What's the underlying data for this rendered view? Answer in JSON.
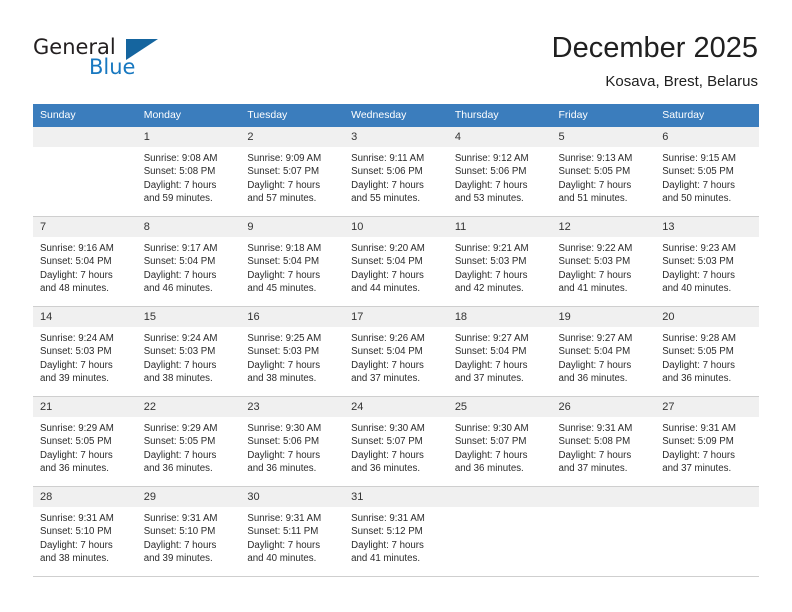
{
  "logo": {
    "word_top": "General",
    "word_bottom": "Blue",
    "triangle_color": "#15659f",
    "text_color": "#231f20",
    "blue_color": "#1878c0"
  },
  "header": {
    "title": "December 2025",
    "subtitle": "Kosava, Brest, Belarus"
  },
  "theme": {
    "header_bg": "#3b7dbd",
    "header_text": "#ffffff",
    "daynum_bg": "#f0f0f0",
    "grid_line": "#cfcfcf"
  },
  "calendar": {
    "weekdays": [
      "Sunday",
      "Monday",
      "Tuesday",
      "Wednesday",
      "Thursday",
      "Friday",
      "Saturday"
    ],
    "weeks": [
      [
        {
          "day": "",
          "sunrise": "",
          "sunset": "",
          "daylight_1": "",
          "daylight_2": ""
        },
        {
          "day": "1",
          "sunrise": "Sunrise: 9:08 AM",
          "sunset": "Sunset: 5:08 PM",
          "daylight_1": "Daylight: 7 hours",
          "daylight_2": "and 59 minutes."
        },
        {
          "day": "2",
          "sunrise": "Sunrise: 9:09 AM",
          "sunset": "Sunset: 5:07 PM",
          "daylight_1": "Daylight: 7 hours",
          "daylight_2": "and 57 minutes."
        },
        {
          "day": "3",
          "sunrise": "Sunrise: 9:11 AM",
          "sunset": "Sunset: 5:06 PM",
          "daylight_1": "Daylight: 7 hours",
          "daylight_2": "and 55 minutes."
        },
        {
          "day": "4",
          "sunrise": "Sunrise: 9:12 AM",
          "sunset": "Sunset: 5:06 PM",
          "daylight_1": "Daylight: 7 hours",
          "daylight_2": "and 53 minutes."
        },
        {
          "day": "5",
          "sunrise": "Sunrise: 9:13 AM",
          "sunset": "Sunset: 5:05 PM",
          "daylight_1": "Daylight: 7 hours",
          "daylight_2": "and 51 minutes."
        },
        {
          "day": "6",
          "sunrise": "Sunrise: 9:15 AM",
          "sunset": "Sunset: 5:05 PM",
          "daylight_1": "Daylight: 7 hours",
          "daylight_2": "and 50 minutes."
        }
      ],
      [
        {
          "day": "7",
          "sunrise": "Sunrise: 9:16 AM",
          "sunset": "Sunset: 5:04 PM",
          "daylight_1": "Daylight: 7 hours",
          "daylight_2": "and 48 minutes."
        },
        {
          "day": "8",
          "sunrise": "Sunrise: 9:17 AM",
          "sunset": "Sunset: 5:04 PM",
          "daylight_1": "Daylight: 7 hours",
          "daylight_2": "and 46 minutes."
        },
        {
          "day": "9",
          "sunrise": "Sunrise: 9:18 AM",
          "sunset": "Sunset: 5:04 PM",
          "daylight_1": "Daylight: 7 hours",
          "daylight_2": "and 45 minutes."
        },
        {
          "day": "10",
          "sunrise": "Sunrise: 9:20 AM",
          "sunset": "Sunset: 5:04 PM",
          "daylight_1": "Daylight: 7 hours",
          "daylight_2": "and 44 minutes."
        },
        {
          "day": "11",
          "sunrise": "Sunrise: 9:21 AM",
          "sunset": "Sunset: 5:03 PM",
          "daylight_1": "Daylight: 7 hours",
          "daylight_2": "and 42 minutes."
        },
        {
          "day": "12",
          "sunrise": "Sunrise: 9:22 AM",
          "sunset": "Sunset: 5:03 PM",
          "daylight_1": "Daylight: 7 hours",
          "daylight_2": "and 41 minutes."
        },
        {
          "day": "13",
          "sunrise": "Sunrise: 9:23 AM",
          "sunset": "Sunset: 5:03 PM",
          "daylight_1": "Daylight: 7 hours",
          "daylight_2": "and 40 minutes."
        }
      ],
      [
        {
          "day": "14",
          "sunrise": "Sunrise: 9:24 AM",
          "sunset": "Sunset: 5:03 PM",
          "daylight_1": "Daylight: 7 hours",
          "daylight_2": "and 39 minutes."
        },
        {
          "day": "15",
          "sunrise": "Sunrise: 9:24 AM",
          "sunset": "Sunset: 5:03 PM",
          "daylight_1": "Daylight: 7 hours",
          "daylight_2": "and 38 minutes."
        },
        {
          "day": "16",
          "sunrise": "Sunrise: 9:25 AM",
          "sunset": "Sunset: 5:03 PM",
          "daylight_1": "Daylight: 7 hours",
          "daylight_2": "and 38 minutes."
        },
        {
          "day": "17",
          "sunrise": "Sunrise: 9:26 AM",
          "sunset": "Sunset: 5:04 PM",
          "daylight_1": "Daylight: 7 hours",
          "daylight_2": "and 37 minutes."
        },
        {
          "day": "18",
          "sunrise": "Sunrise: 9:27 AM",
          "sunset": "Sunset: 5:04 PM",
          "daylight_1": "Daylight: 7 hours",
          "daylight_2": "and 37 minutes."
        },
        {
          "day": "19",
          "sunrise": "Sunrise: 9:27 AM",
          "sunset": "Sunset: 5:04 PM",
          "daylight_1": "Daylight: 7 hours",
          "daylight_2": "and 36 minutes."
        },
        {
          "day": "20",
          "sunrise": "Sunrise: 9:28 AM",
          "sunset": "Sunset: 5:05 PM",
          "daylight_1": "Daylight: 7 hours",
          "daylight_2": "and 36 minutes."
        }
      ],
      [
        {
          "day": "21",
          "sunrise": "Sunrise: 9:29 AM",
          "sunset": "Sunset: 5:05 PM",
          "daylight_1": "Daylight: 7 hours",
          "daylight_2": "and 36 minutes."
        },
        {
          "day": "22",
          "sunrise": "Sunrise: 9:29 AM",
          "sunset": "Sunset: 5:05 PM",
          "daylight_1": "Daylight: 7 hours",
          "daylight_2": "and 36 minutes."
        },
        {
          "day": "23",
          "sunrise": "Sunrise: 9:30 AM",
          "sunset": "Sunset: 5:06 PM",
          "daylight_1": "Daylight: 7 hours",
          "daylight_2": "and 36 minutes."
        },
        {
          "day": "24",
          "sunrise": "Sunrise: 9:30 AM",
          "sunset": "Sunset: 5:07 PM",
          "daylight_1": "Daylight: 7 hours",
          "daylight_2": "and 36 minutes."
        },
        {
          "day": "25",
          "sunrise": "Sunrise: 9:30 AM",
          "sunset": "Sunset: 5:07 PM",
          "daylight_1": "Daylight: 7 hours",
          "daylight_2": "and 36 minutes."
        },
        {
          "day": "26",
          "sunrise": "Sunrise: 9:31 AM",
          "sunset": "Sunset: 5:08 PM",
          "daylight_1": "Daylight: 7 hours",
          "daylight_2": "and 37 minutes."
        },
        {
          "day": "27",
          "sunrise": "Sunrise: 9:31 AM",
          "sunset": "Sunset: 5:09 PM",
          "daylight_1": "Daylight: 7 hours",
          "daylight_2": "and 37 minutes."
        }
      ],
      [
        {
          "day": "28",
          "sunrise": "Sunrise: 9:31 AM",
          "sunset": "Sunset: 5:10 PM",
          "daylight_1": "Daylight: 7 hours",
          "daylight_2": "and 38 minutes."
        },
        {
          "day": "29",
          "sunrise": "Sunrise: 9:31 AM",
          "sunset": "Sunset: 5:10 PM",
          "daylight_1": "Daylight: 7 hours",
          "daylight_2": "and 39 minutes."
        },
        {
          "day": "30",
          "sunrise": "Sunrise: 9:31 AM",
          "sunset": "Sunset: 5:11 PM",
          "daylight_1": "Daylight: 7 hours",
          "daylight_2": "and 40 minutes."
        },
        {
          "day": "31",
          "sunrise": "Sunrise: 9:31 AM",
          "sunset": "Sunset: 5:12 PM",
          "daylight_1": "Daylight: 7 hours",
          "daylight_2": "and 41 minutes."
        },
        {
          "day": "",
          "sunrise": "",
          "sunset": "",
          "daylight_1": "",
          "daylight_2": ""
        },
        {
          "day": "",
          "sunrise": "",
          "sunset": "",
          "daylight_1": "",
          "daylight_2": ""
        },
        {
          "day": "",
          "sunrise": "",
          "sunset": "",
          "daylight_1": "",
          "daylight_2": ""
        }
      ]
    ]
  }
}
